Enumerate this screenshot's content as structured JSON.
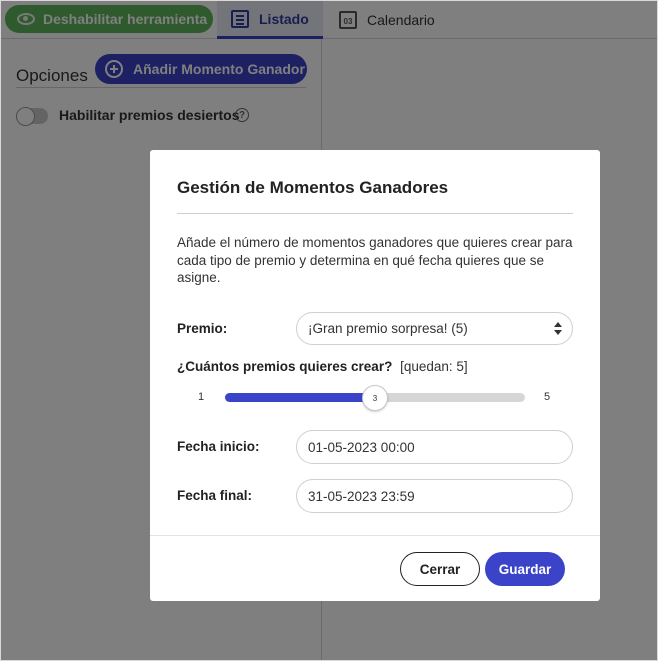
{
  "toolbar": {
    "disable_tool_label": "Deshabilitar herramienta",
    "tabs": [
      {
        "label": "Listado",
        "active": true
      },
      {
        "label": "Calendario",
        "active": false,
        "icon_text": "03"
      }
    ]
  },
  "sidebar": {
    "title": "Opciones",
    "add_button_label": "Añadir Momento Ganador",
    "toggle_label": "Habilitar premios desiertos",
    "toggle_on": false,
    "help_icon_text": "?"
  },
  "modal": {
    "title": "Gestión de Momentos Ganadores",
    "description": "Añade el número de momentos ganadores que quieres crear para cada tipo de premio y determina en qué fecha quieres que se asigne.",
    "premio_label": "Premio:",
    "premio_selected": "¡Gran premio sorpresa! (5)",
    "question_label": "¿Cuántos premios quieres crear?",
    "remaining_text": "[quedan: 5]",
    "slider": {
      "min": 1,
      "max": 5,
      "value": 3
    },
    "fecha_inicio_label": "Fecha inicio:",
    "fecha_inicio_value": "01-05-2023 00:00",
    "fecha_final_label": "Fecha final:",
    "fecha_final_value": "31-05-2023 23:59",
    "close_label": "Cerrar",
    "save_label": "Guardar"
  },
  "colors": {
    "accent": "#3b43c9",
    "success": "#5db55d"
  }
}
